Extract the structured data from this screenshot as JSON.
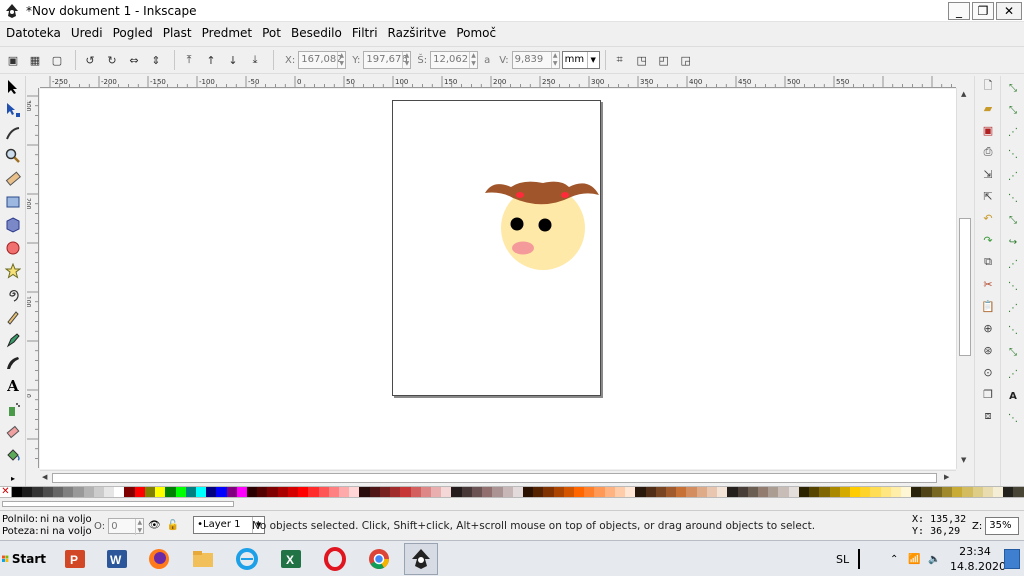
{
  "window": {
    "title": "*Nov dokument 1 - Inkscape",
    "controls": [
      "_",
      "❐",
      "✕"
    ]
  },
  "menu": [
    "Datoteka",
    "Uredi",
    "Pogled",
    "Plast",
    "Predmet",
    "Pot",
    "Besedilo",
    "Filtri",
    "Razširitve",
    "Pomoč"
  ],
  "tool_controls": {
    "x_label": "X:",
    "x_value": "167,082",
    "y_label": "Y:",
    "y_value": "197,676",
    "w_label": "Š:",
    "w_value": "12,062",
    "h_label": "V:",
    "h_value": "9,839",
    "lock_symbol": "a",
    "unit": "mm"
  },
  "rulers": {
    "top_ticks": [
      "-250",
      "-200",
      "-150",
      "-100",
      "-50",
      "0",
      "50",
      "100",
      "150",
      "200",
      "250",
      "300",
      "350",
      "400",
      "450",
      "500",
      "550"
    ],
    "left_ticks": [
      "300",
      "200",
      "100",
      "0"
    ]
  },
  "statusbar": {
    "fill_label": "Polnilo:",
    "fill_value": "ni na voljo",
    "stroke_label": "Poteza:",
    "stroke_value": "ni na voljo",
    "opacity_label": "O:",
    "opacity_value": "0",
    "layer": "•Layer 1",
    "message": "No objects selected. Click, Shift+click, Alt+scroll mouse on top of objects, or drag around objects to select.",
    "cursor_x_label": "X:",
    "cursor_x": "135,32",
    "cursor_y_label": "Y:",
    "cursor_y": "36,29",
    "zoom_label": "Z:",
    "zoom": "35%"
  },
  "taskbar": {
    "start_label": "Start",
    "apps": [
      "powerpoint-icon",
      "word-icon",
      "firefox-icon",
      "explorer-icon",
      "internet-explorer-icon",
      "excel-icon",
      "opera-icon",
      "chrome-icon",
      "inkscape-icon"
    ],
    "language": "SL",
    "time": "23:34",
    "date": "14.8.2020"
  },
  "palette": [
    "#000000",
    "#1a1a1a",
    "#333333",
    "#4d4d4d",
    "#666666",
    "#808080",
    "#999999",
    "#b3b3b3",
    "#cccccc",
    "#e6e6e6",
    "#ffffff",
    "#800000",
    "#ff0000",
    "#808000",
    "#ffff00",
    "#008000",
    "#00ff00",
    "#008080",
    "#00ffff",
    "#000080",
    "#0000ff",
    "#800080",
    "#ff00ff",
    "#2b0000",
    "#550000",
    "#800000",
    "#aa0000",
    "#d40000",
    "#ff0000",
    "#ff2a2a",
    "#ff5555",
    "#ff8080",
    "#ffaaaa",
    "#ffd5d5",
    "#280b0b",
    "#501616",
    "#782121",
    "#a02c2c",
    "#c83737",
    "#d35f5f",
    "#de8787",
    "#e9afaf",
    "#f4d7d7",
    "#241c1c",
    "#483737",
    "#6c5353",
    "#916f6f",
    "#ac9393",
    "#c8b7b7",
    "#e3dbdb",
    "#2b1100",
    "#552200",
    "#803300",
    "#aa4400",
    "#d45500",
    "#ff6600",
    "#ff7f2a",
    "#ff9955",
    "#ffb380",
    "#ffccaa",
    "#ffe6d5",
    "#28170b",
    "#502d16",
    "#784421",
    "#a05a2c",
    "#c87137",
    "#d38d5f",
    "#deaa87",
    "#e9c6af",
    "#f4e3d7",
    "#241f1c",
    "#483e37",
    "#6c5d53",
    "#917c6f",
    "#ac9d93",
    "#c8beb7",
    "#e3dedb",
    "#2b2200",
    "#554400",
    "#806600",
    "#aa8800",
    "#d4aa00",
    "#ffcc00",
    "#ffd42a",
    "#ffdd55",
    "#ffe680",
    "#ffeeaa",
    "#fff6d5",
    "#28220b",
    "#504416",
    "#786721",
    "#a0892c",
    "#c8ab37",
    "#d3bc5f",
    "#decd87",
    "#e9ddaf",
    "#f4eed7",
    "#24221c",
    "#484537"
  ]
}
